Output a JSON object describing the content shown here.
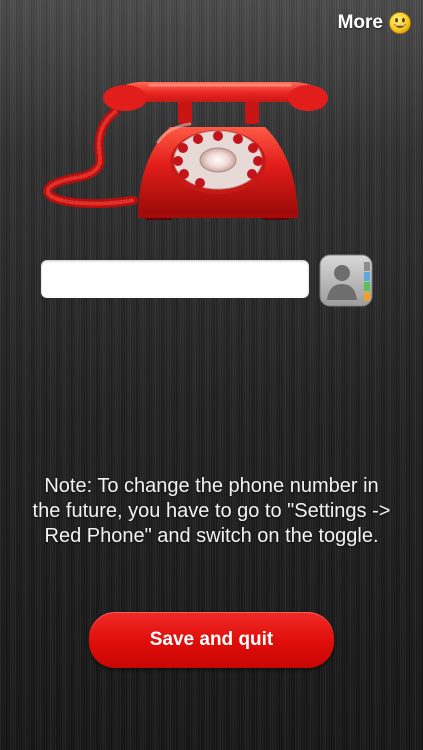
{
  "header": {
    "more_label": "More",
    "more_icon": "smiley-icon"
  },
  "illustration": {
    "icon": "rotary-telephone-icon",
    "color": "#e21d1a"
  },
  "phone_input": {
    "value": "",
    "placeholder": ""
  },
  "contacts": {
    "icon": "contacts-book-icon"
  },
  "note": {
    "text": "Note: To change the phone number in the future, you have to go to \"Settings -> Red Phone\" and switch on the toggle."
  },
  "actions": {
    "save_label": "Save and quit",
    "save_color": "#de0d0a"
  }
}
